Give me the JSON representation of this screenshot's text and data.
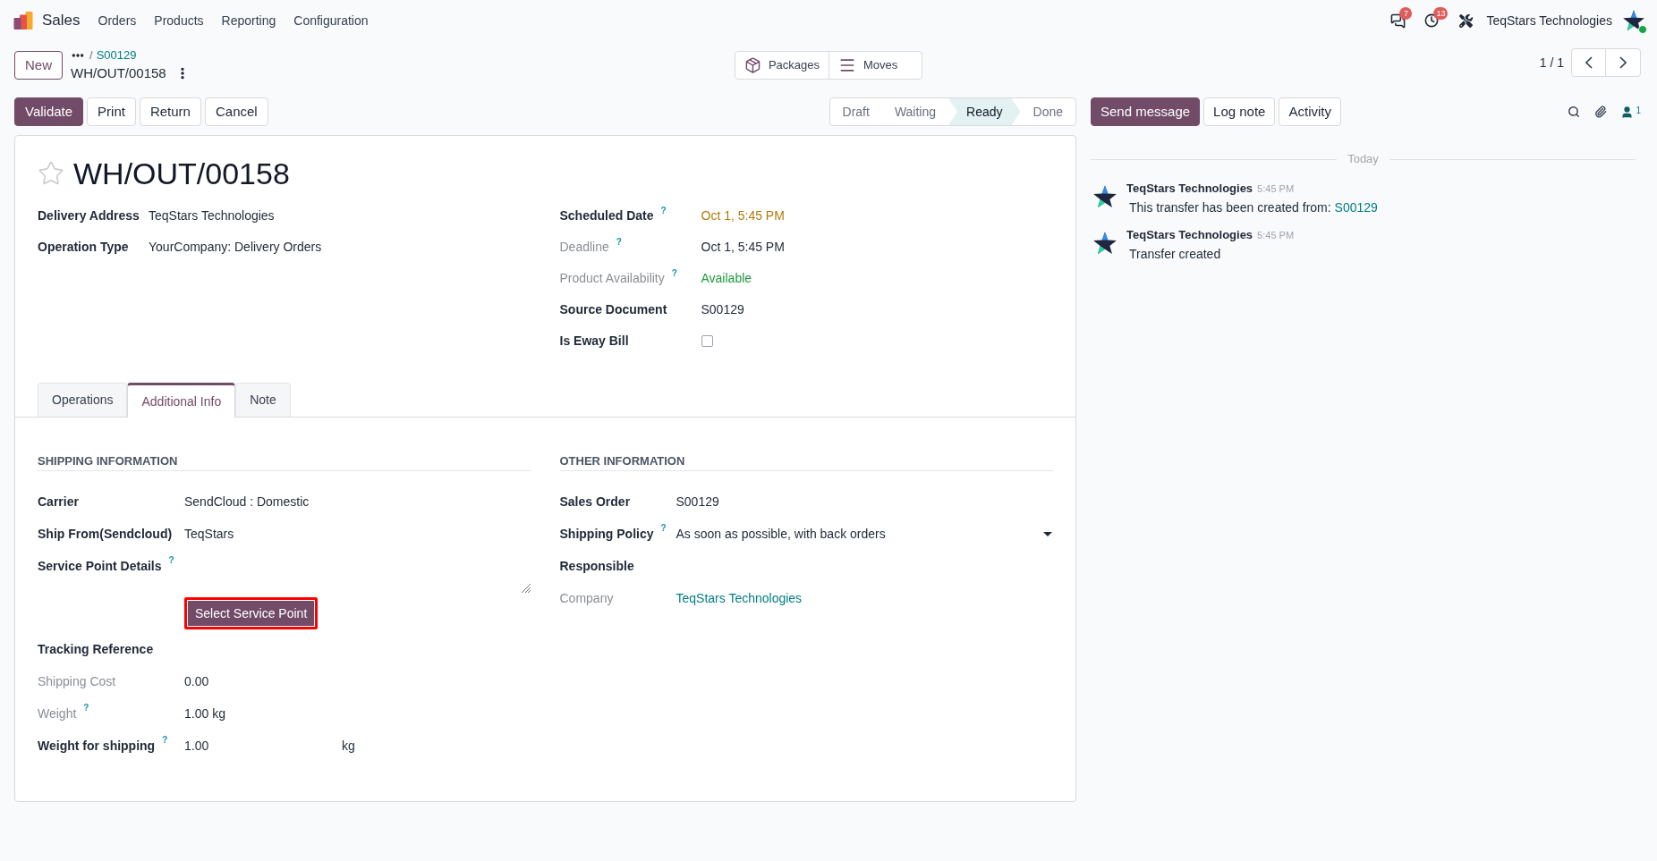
{
  "navbar": {
    "app_name": "Sales",
    "menu": [
      "Orders",
      "Products",
      "Reporting",
      "Configuration"
    ],
    "systray": [
      {
        "kind": "messages",
        "badge": "7"
      },
      {
        "kind": "activities",
        "badge": "13"
      },
      {
        "kind": "tools"
      }
    ],
    "user": "TeqStars Technologies"
  },
  "control_panel": {
    "new_button": "New",
    "breadcrumb": {
      "separator": "/",
      "parent": "S00129",
      "current": "WH/OUT/00158"
    },
    "smart_buttons": [
      {
        "kind": "packages",
        "label": "Packages"
      },
      {
        "kind": "moves",
        "label": "Moves"
      }
    ],
    "pager": "1 / 1"
  },
  "actions": [
    {
      "label": "Validate",
      "primary": true
    },
    {
      "label": "Print",
      "primary": false
    },
    {
      "label": "Return",
      "primary": false
    },
    {
      "label": "Cancel",
      "primary": false
    }
  ],
  "status_bar": [
    {
      "label": "Draft",
      "selected": false
    },
    {
      "label": "Waiting",
      "selected": false
    },
    {
      "label": "Ready",
      "selected": true
    },
    {
      "label": "Done",
      "selected": false
    }
  ],
  "form": {
    "starred": false,
    "title": "WH/OUT/00158",
    "left_fields": [
      {
        "label": "Delivery Address",
        "readonly": false,
        "value": "TeqStars Technologies"
      },
      {
        "label": "Operation Type",
        "readonly": false,
        "value": "YourCompany: Delivery Orders"
      }
    ],
    "right_fields": [
      {
        "kind": "text",
        "label": "Scheduled Date",
        "readonly": false,
        "help": "?",
        "value": "Oct 1, 5:45 PM",
        "color": "#b07a0c"
      },
      {
        "kind": "text",
        "label": "Deadline",
        "readonly": true,
        "help": "?",
        "value": "Oct 1, 5:45 PM"
      },
      {
        "kind": "text",
        "label": "Product Availability",
        "readonly": true,
        "help": "?",
        "value": "Available",
        "color": "#1f9a3c"
      },
      {
        "kind": "text",
        "label": "Source Document",
        "readonly": false,
        "value": "S00129"
      },
      {
        "kind": "checkbox",
        "label": "Is Eway Bill",
        "readonly": false,
        "checked": false
      }
    ],
    "tabs": [
      {
        "label": "Operations",
        "selected": false
      },
      {
        "label": "Additional Info",
        "selected": true
      },
      {
        "label": "Note",
        "selected": false
      }
    ],
    "sections": [
      {
        "title": "SHIPPING INFORMATION",
        "fields": [
          {
            "kind": "text",
            "label": "Carrier",
            "readonly": false,
            "value": "SendCloud : Domestic"
          },
          {
            "kind": "text",
            "label": "Ship From(Sendcloud)",
            "readonly": false,
            "value": "TeqStars"
          },
          {
            "kind": "textarea",
            "label": "Service Point Details",
            "readonly": false,
            "help": "?",
            "button": {
              "label": "Select Service Point",
              "highlighted": true
            }
          },
          {
            "kind": "text",
            "label": "Tracking Reference",
            "readonly": false
          },
          {
            "kind": "text",
            "label": "Shipping Cost",
            "readonly": true,
            "value": "0.00"
          },
          {
            "kind": "text",
            "label": "Weight",
            "readonly": true,
            "help": "?",
            "value": "1.00 kg"
          },
          {
            "kind": "unit",
            "label": "Weight for shipping",
            "readonly": false,
            "help": "?",
            "value": "1.00",
            "unit": "kg"
          }
        ]
      },
      {
        "title": "OTHER INFORMATION",
        "fields": [
          {
            "kind": "text",
            "label": "Sales Order",
            "readonly": false,
            "value": "S00129"
          },
          {
            "kind": "select",
            "label": "Shipping Policy",
            "readonly": false,
            "help": "?",
            "value": "As soon as possible, with back orders"
          },
          {
            "kind": "text",
            "label": "Responsible",
            "readonly": false
          },
          {
            "kind": "link",
            "label": "Company",
            "readonly": true,
            "value": "TeqStars Technologies"
          }
        ]
      }
    ]
  },
  "chatter": {
    "buttons": [
      {
        "label": "Send message",
        "primary": true
      },
      {
        "label": "Log note",
        "primary": false
      },
      {
        "label": "Activity",
        "primary": false
      }
    ],
    "followers": "1",
    "date_divider": "Today",
    "messages": [
      {
        "author": "TeqStars Technologies",
        "time": "5:45 PM",
        "body": "This transfer has been created from:",
        "link": "S00129"
      },
      {
        "author": "TeqStars Technologies",
        "time": "5:45 PM",
        "body": "Transfer created"
      }
    ]
  }
}
